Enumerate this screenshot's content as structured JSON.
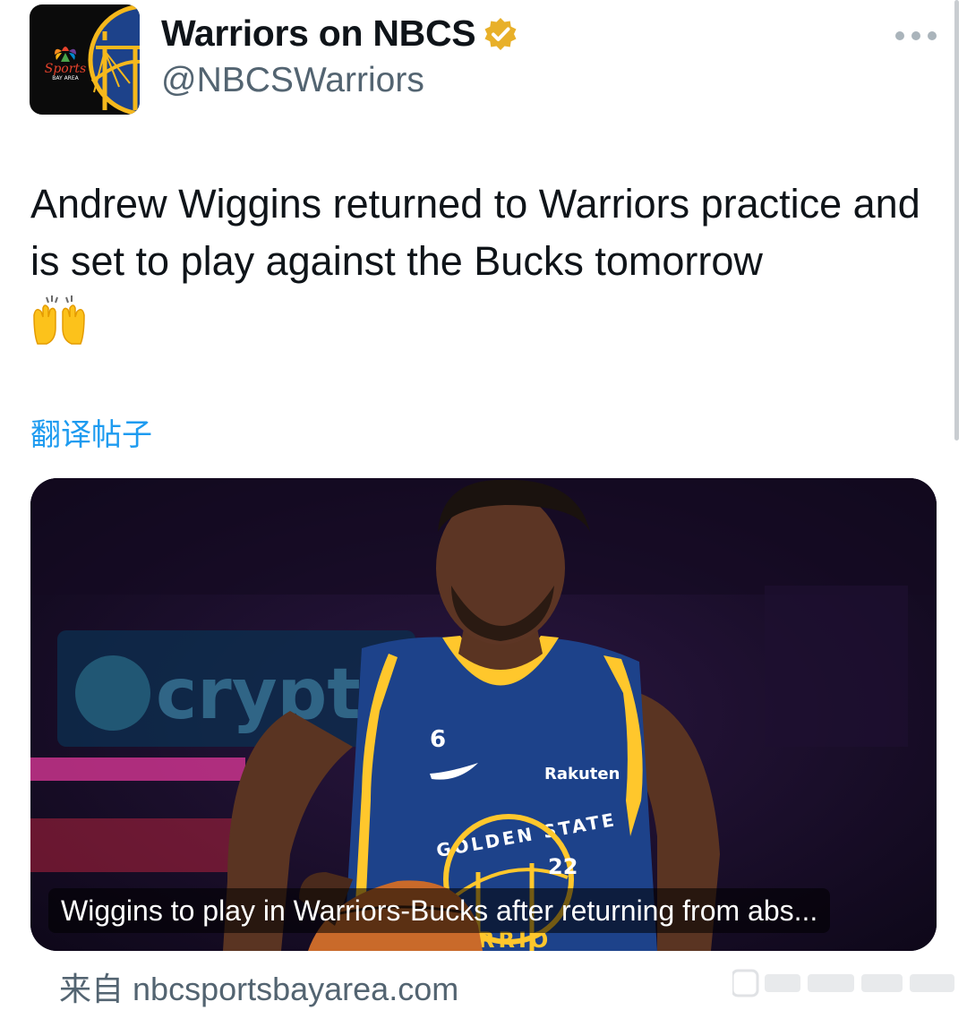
{
  "author": {
    "display_name": "Warriors on NBCS",
    "handle": "@NBCSWarriors",
    "verified": true,
    "avatar_icon": "nbc-sports-bay-area-warriors-logo",
    "avatar_logo_text": "Sports",
    "avatar_logo_subtext": "BAY AREA"
  },
  "more_icon": "more-dots-icon",
  "post": {
    "text": "Andrew Wiggins returned to Warriors practice and is set to play against the Bucks tomorrow",
    "emoji": "🙌",
    "translate_label": "翻译帖子"
  },
  "card": {
    "caption": "Wiggins to play in Warriors-Bucks after returning from abs...",
    "source_prefix": "来自",
    "source_domain": "nbcsportsbayarea.com",
    "image_text": {
      "jersey_number_small": "6",
      "sponsor": "Rakuten",
      "team_arc": "GOLDEN STATE",
      "logo_number": "22",
      "bottom_letters": "RRIO",
      "background_sign": "crypto"
    }
  },
  "colors": {
    "link_blue": "#1d9bf0",
    "secondary_text": "#536471",
    "verified_gold": "#e8b029",
    "jersey_blue": "#1d428a",
    "jersey_yellow": "#ffc72c"
  }
}
